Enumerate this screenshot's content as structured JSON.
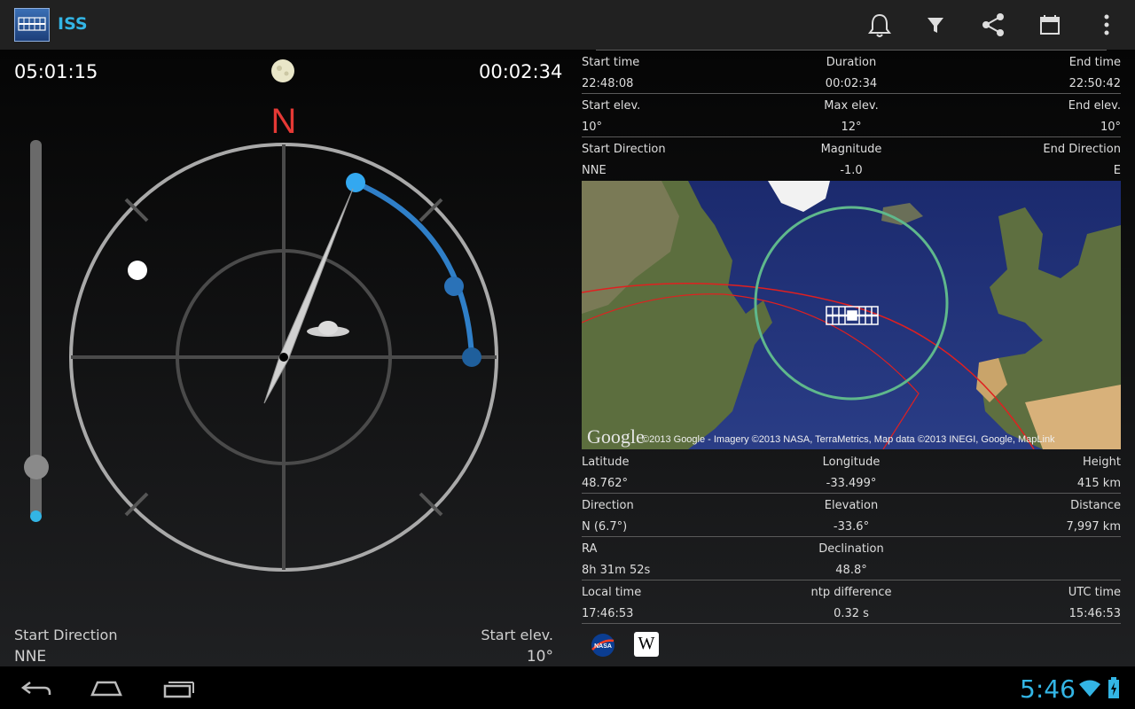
{
  "app": {
    "title": "ISS"
  },
  "header": {
    "time_left": "05:01:15",
    "time_right": "00:02:34"
  },
  "compass": {
    "north_label": "N"
  },
  "bottom": {
    "start_direction_label": "Start Direction",
    "start_direction_value": "NNE",
    "start_elev_label": "Start elev.",
    "start_elev_value": "10°"
  },
  "pass_info": {
    "start_time_label": "Start time",
    "start_time": "22:48:08",
    "duration_label": "Duration",
    "duration": "00:02:34",
    "end_time_label": "End time",
    "end_time": "22:50:42",
    "start_elev_label": "Start elev.",
    "start_elev": "10°",
    "max_elev_label": "Max elev.",
    "max_elev": "12°",
    "end_elev_label": "End elev.",
    "end_elev": "10°",
    "start_dir_label": "Start Direction",
    "start_dir": "NNE",
    "magnitude_label": "Magnitude",
    "magnitude": "-1.0",
    "end_dir_label": "End Direction",
    "end_dir": "E"
  },
  "map": {
    "google_logo": "Google",
    "attribution": "©2013 Google - Imagery ©2013 NASA, TerraMetrics, Map data ©2013 INEGI, Google, MapLink"
  },
  "position": {
    "latitude_label": "Latitude",
    "latitude": "48.762°",
    "longitude_label": "Longitude",
    "longitude": "-33.499°",
    "height_label": "Height",
    "height": "415 km",
    "direction_label": "Direction",
    "direction": "N (6.7°)",
    "elevation_label": "Elevation",
    "elevation": "-33.6°",
    "distance_label": "Distance",
    "distance": "7,997 km",
    "ra_label": "RA",
    "ra": "8h 31m 52s",
    "declination_label": "Declination",
    "declination": "48.8°",
    "local_time_label": "Local time",
    "local_time": "17:46:53",
    "ntp_label": "ntp difference",
    "ntp": "0.32 s",
    "utc_label": "UTC time",
    "utc": "15:46:53"
  },
  "links": {
    "nasa": "NASA",
    "wikipedia": "W"
  },
  "system": {
    "clock": "5:46"
  },
  "colors": {
    "accent": "#33b5e5",
    "path": "#2f7fc8",
    "north": "#e53935",
    "footprint": "#4caf7f",
    "ground_track": "#e02020"
  }
}
